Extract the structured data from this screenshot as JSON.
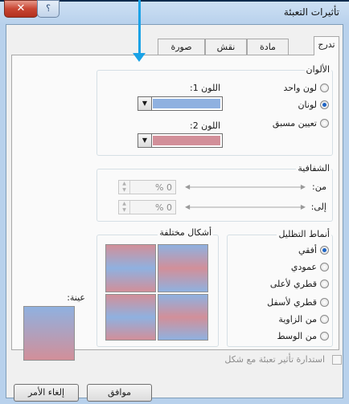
{
  "window": {
    "title": "تأثيرات التعبئة",
    "close_glyph": "✕",
    "help_glyph": "؟"
  },
  "tabs": [
    {
      "label": "تدرج",
      "active": true
    },
    {
      "label": "مادة",
      "active": false
    },
    {
      "label": "نقش",
      "active": false
    },
    {
      "label": "صورة",
      "active": false
    }
  ],
  "colors": {
    "group_label": "الألوان",
    "options": [
      {
        "label": "لون واحد",
        "selected": false
      },
      {
        "label": "لونان",
        "selected": true
      },
      {
        "label": "تعيين مسبق",
        "selected": false
      }
    ],
    "color1_label": "اللون 1:",
    "color2_label": "اللون 2:",
    "color1_value": "#8fb1e0",
    "color2_value": "#d28f99"
  },
  "transparency": {
    "group_label": "الشفافية",
    "from_label": "من:",
    "to_label": "إلى:",
    "from_value": "0 %",
    "to_value": "0 %"
  },
  "shading": {
    "group_label": "أنماط التظليل",
    "options": [
      {
        "label": "أفقي",
        "selected": true
      },
      {
        "label": "عمودي",
        "selected": false
      },
      {
        "label": "قطري لأعلى",
        "selected": false
      },
      {
        "label": "قطري لأسفل",
        "selected": false
      },
      {
        "label": "من الزاوية",
        "selected": false
      },
      {
        "label": "من الوسط",
        "selected": false
      }
    ]
  },
  "variants": {
    "group_label": "أشكال مختلفة"
  },
  "sample": {
    "label": "عينة:"
  },
  "rotate_checkbox": {
    "label": "استدارة تأثير تعبئة مع شكل",
    "checked": false
  },
  "buttons": {
    "ok": "موافق",
    "cancel": "إلغاء الأمر"
  }
}
